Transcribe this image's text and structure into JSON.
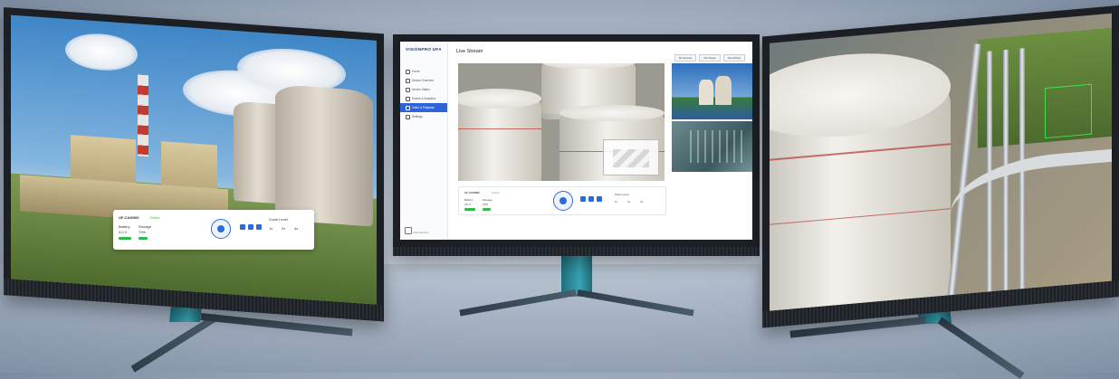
{
  "center_app": {
    "brand": "VISIONPRO UFA",
    "page_title": "Live Stream",
    "top_buttons": [
      "All cameras",
      "Grid layout",
      "Recordings"
    ],
    "nav_items": [
      {
        "label": "Home",
        "active": false
      },
      {
        "label": "Device Overview",
        "active": false
      },
      {
        "label": "Device Status",
        "active": false
      },
      {
        "label": "Events & Analytics",
        "active": false
      },
      {
        "label": "Video & Playback",
        "active": true
      },
      {
        "label": "Settings",
        "active": false
      }
    ],
    "footer_label": "Administrator",
    "control_panel": {
      "device_name": "UF-CAM360",
      "status": "Online",
      "metrics": [
        {
          "label": "Battery",
          "value": "4.0 V"
        },
        {
          "label": "Storage",
          "value": "70%"
        }
      ],
      "zoom_label": "Zoom Level",
      "zoom_options": [
        "1x",
        "2x",
        "4x"
      ]
    }
  },
  "left_panel": {
    "device_name": "UF-CAM360",
    "status": "Online",
    "metrics": [
      {
        "label": "Battery",
        "value": "4.0 V"
      },
      {
        "label": "Storage",
        "value": "70%"
      }
    ],
    "zoom_label": "Zoom Level",
    "zoom_options": [
      "1x",
      "2x",
      "4x"
    ]
  },
  "colors": {
    "accent": "#2f63d8",
    "status_ok": "#2fb84b",
    "stand": "#2d9cae",
    "tank_stripe": "#b53a34"
  },
  "icons": [
    "dpad-control-icon",
    "arrow-left-icon",
    "arrow-center-icon",
    "arrow-right-icon",
    "user-icon"
  ]
}
